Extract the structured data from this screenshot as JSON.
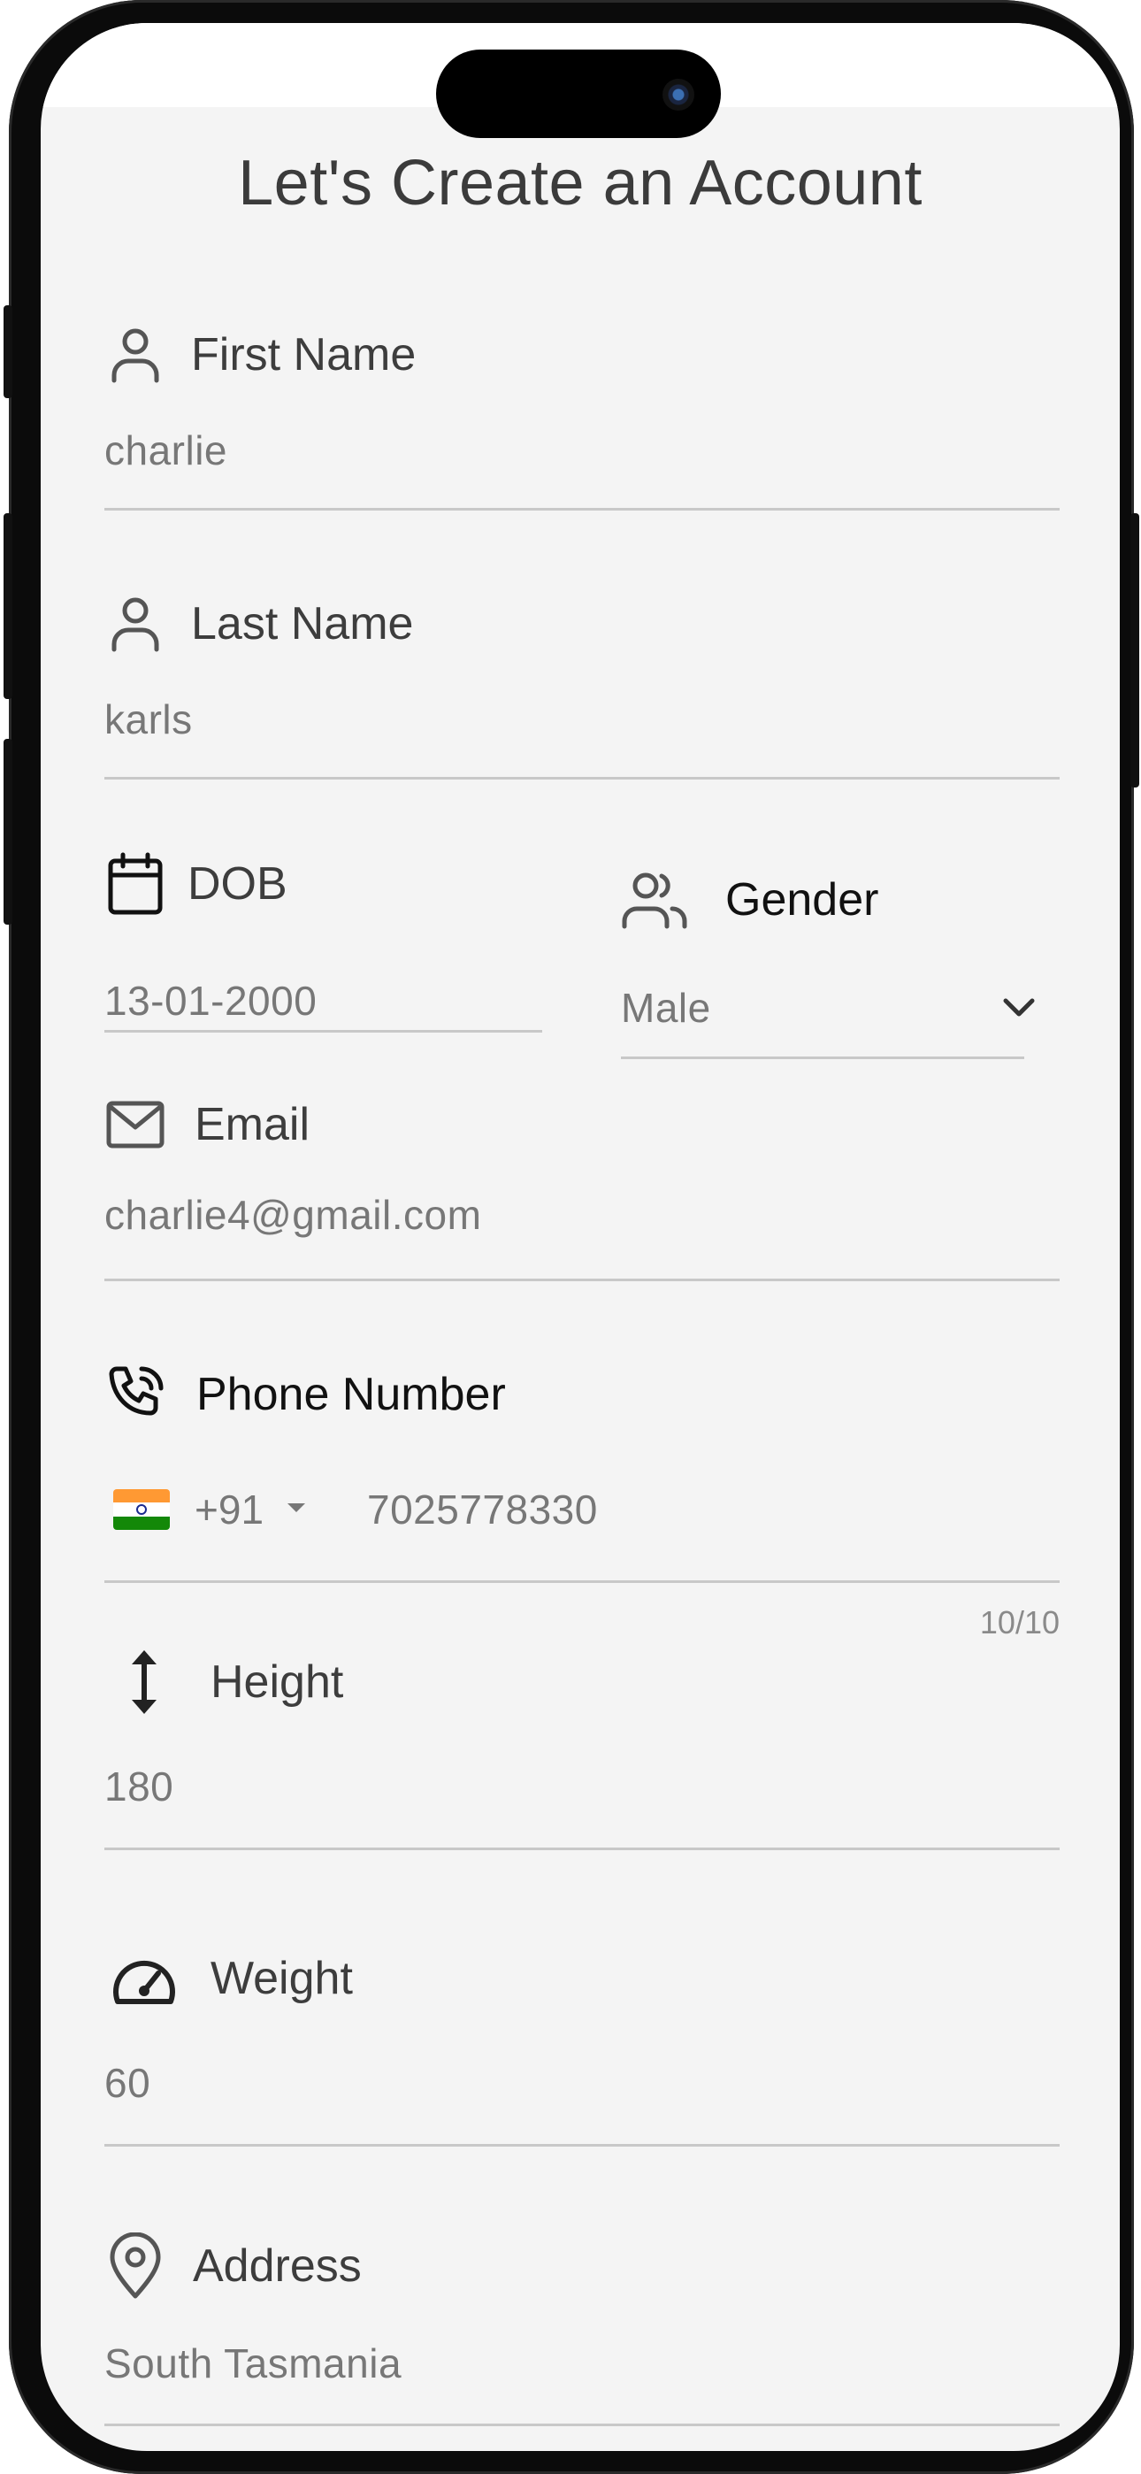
{
  "title": "Let's Create an Account",
  "first_name": {
    "label": "First Name",
    "value": "charlie",
    "icon": "person-icon"
  },
  "last_name": {
    "label": "Last Name",
    "value": "karls",
    "icon": "person-icon"
  },
  "dob": {
    "label": "DOB",
    "value": "13-01-2000",
    "icon": "calendar-icon"
  },
  "gender": {
    "label": "Gender",
    "value": "Male",
    "icon": "people-icon"
  },
  "email": {
    "label": "Email",
    "value": "charlie4@gmail.com",
    "icon": "envelope-icon"
  },
  "phone": {
    "label": "Phone Number",
    "country_code": "+91",
    "value": "7025778330",
    "counter": "10/10",
    "icon": "phone-ringing-icon",
    "flag": "india-flag-icon"
  },
  "height": {
    "label": "Height",
    "value": "180",
    "icon": "vertical-arrows-icon"
  },
  "weight": {
    "label": "Weight",
    "value": "60",
    "icon": "gauge-icon"
  },
  "address": {
    "label": "Address",
    "value": "South Tasmania",
    "icon": "map-pin-icon"
  },
  "colors": {
    "background": "#f4f4f4",
    "text": "#3d3d3d",
    "value_text": "#777777",
    "underline": "#c8c8c8"
  }
}
